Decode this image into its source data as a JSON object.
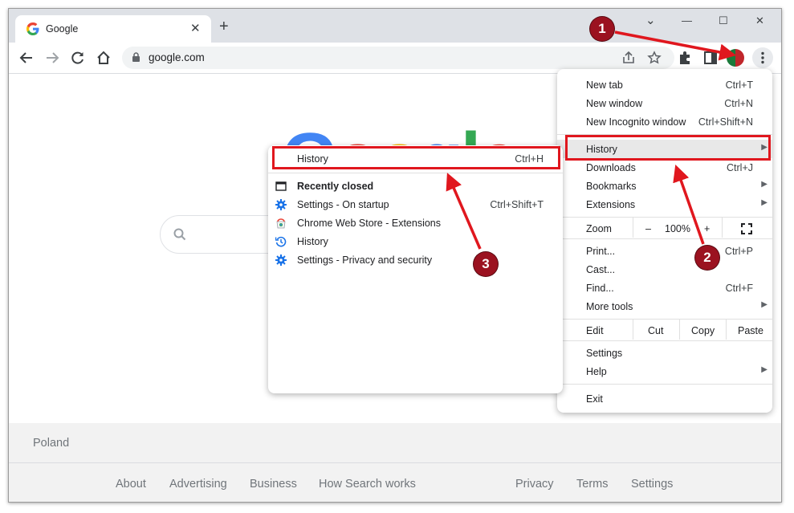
{
  "tab": {
    "title": "Google",
    "close": "✕"
  },
  "new_tab_symbol": "+",
  "window_controls": {
    "minimize": "—",
    "maximize": "☐",
    "close": "✕",
    "chevron": "⌄"
  },
  "address_bar": {
    "url": "google.com"
  },
  "footer": {
    "country": "Poland",
    "links_left": [
      "About",
      "Advertising",
      "Business",
      "How Search works"
    ],
    "links_right": [
      "Privacy",
      "Terms",
      "Settings"
    ]
  },
  "chrome_menu": {
    "items_top": [
      {
        "label": "New tab",
        "shortcut": "Ctrl+T"
      },
      {
        "label": "New window",
        "shortcut": "Ctrl+N"
      },
      {
        "label": "New Incognito window",
        "shortcut": "Ctrl+Shift+N"
      }
    ],
    "history": {
      "label": "History"
    },
    "items_mid": [
      {
        "label": "Downloads",
        "shortcut": "Ctrl+J"
      },
      {
        "label": "Bookmarks"
      },
      {
        "label": "Extensions"
      }
    ],
    "zoom": {
      "label": "Zoom",
      "minus": "–",
      "value": "100%",
      "plus": "+"
    },
    "items_tools": [
      {
        "label": "Print...",
        "shortcut": "Ctrl+P"
      },
      {
        "label": "Cast..."
      },
      {
        "label": "Find...",
        "shortcut": "Ctrl+F"
      },
      {
        "label": "More tools"
      }
    ],
    "edit": {
      "label": "Edit",
      "cut": "Cut",
      "copy": "Copy",
      "paste": "Paste"
    },
    "settings": "Settings",
    "help": "Help",
    "exit": "Exit"
  },
  "history_submenu": {
    "history": {
      "label": "History",
      "shortcut": "Ctrl+H"
    },
    "recently_closed": "Recently closed",
    "entries": [
      {
        "label": "Settings - On startup",
        "shortcut": "Ctrl+Shift+T",
        "icon": "gear-icon"
      },
      {
        "label": "Chrome Web Store - Extensions",
        "icon": "chrome-web-store-icon"
      },
      {
        "label": "History",
        "icon": "history-clock-icon"
      },
      {
        "label": "Settings - Privacy and security",
        "icon": "gear-icon"
      }
    ]
  },
  "annotations": {
    "badge1": "1",
    "badge2": "2",
    "badge3": "3"
  },
  "colors": {
    "annotation_red": "#e0171e",
    "badge": "#9b1220",
    "titlebar": "#dee1e6"
  }
}
